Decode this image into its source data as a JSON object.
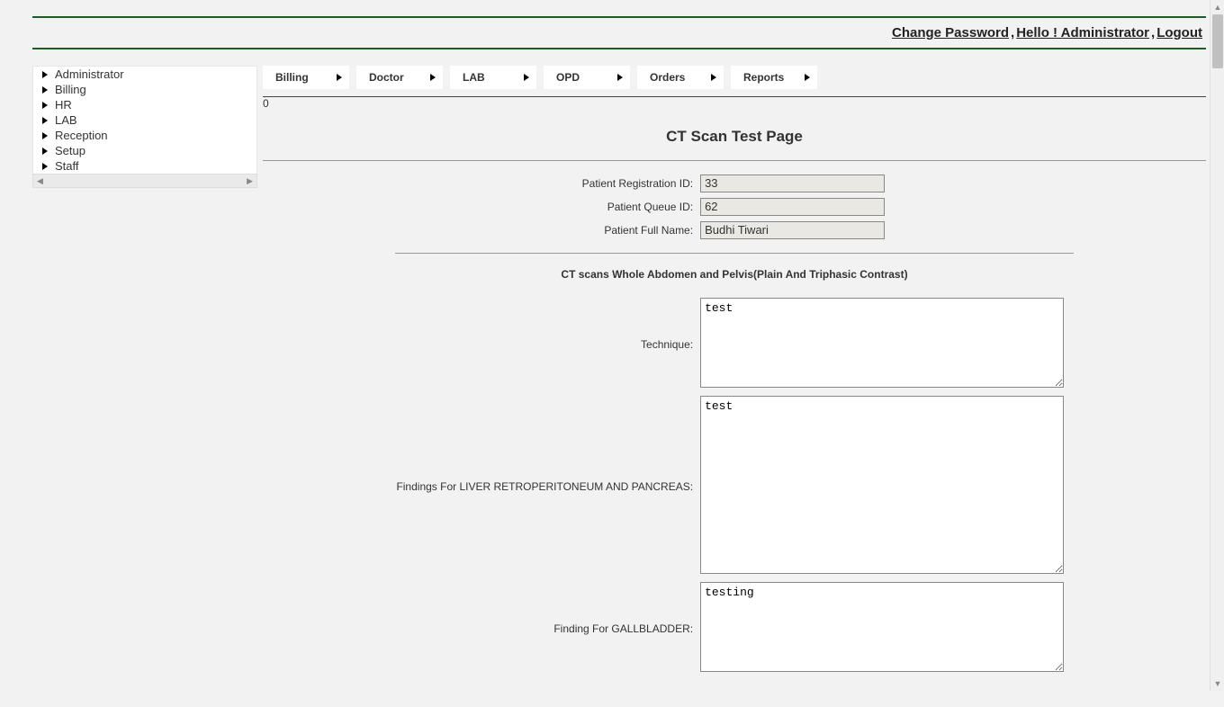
{
  "topbar": {
    "change_password": "Change Password",
    "greeting": "Hello ! Administrator ",
    "logout": "Logout"
  },
  "sidebar": {
    "items": [
      {
        "label": "Administrator"
      },
      {
        "label": "Billing"
      },
      {
        "label": "HR"
      },
      {
        "label": "LAB"
      },
      {
        "label": "Reception"
      },
      {
        "label": "Setup"
      },
      {
        "label": "Staff"
      }
    ]
  },
  "tabs": [
    {
      "label": "Billing"
    },
    {
      "label": "Doctor"
    },
    {
      "label": "LAB"
    },
    {
      "label": "OPD"
    },
    {
      "label": "Orders"
    },
    {
      "label": "Reports"
    }
  ],
  "stray_zero": "0",
  "page_title": "CT Scan Test Page",
  "patient": {
    "reg_id_label": "Patient Registration ID:",
    "reg_id_value": "33",
    "queue_id_label": "Patient Queue ID:",
    "queue_id_value": "62",
    "full_name_label": "Patient Full Name:",
    "full_name_value": "Budhi Tiwari"
  },
  "scan": {
    "heading": "CT scans Whole Abdomen and Pelvis(Plain And Triphasic Contrast)",
    "technique_label": "Technique:",
    "technique_value": "test",
    "findings_liver_label": "Findings For LIVER RETROPERITONEUM AND PANCREAS:",
    "findings_liver_value": "test",
    "findings_gall_label": "Finding For GALLBLADDER:",
    "findings_gall_value": "testing"
  }
}
